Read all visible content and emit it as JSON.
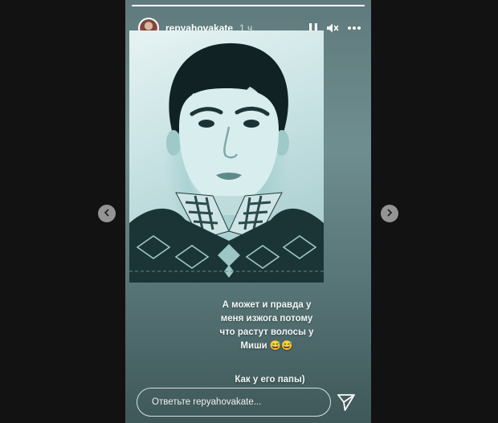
{
  "story": {
    "progress": 1.0,
    "user": {
      "username": "repyahovakate",
      "time_ago": "1 ч."
    },
    "controls": {
      "pause_icon": "pause-icon",
      "mute_icon": "mute-icon",
      "more_icon": "more-icon"
    },
    "caption_lines": [
      "А может и правда у",
      "меня изжога потому",
      "что растут волосы у",
      "Миши 😅😅"
    ],
    "second_caption": "Как у его папы)",
    "reply": {
      "placeholder": "Ответьте repyahovakate..."
    },
    "send_icon": "send-icon"
  },
  "nav": {
    "prev_icon": "chevron-left-icon",
    "next_icon": "chevron-right-icon"
  },
  "colors": {
    "background": "#121212",
    "story_bg": "#5f7a7c",
    "text": "#f2f7f7"
  }
}
